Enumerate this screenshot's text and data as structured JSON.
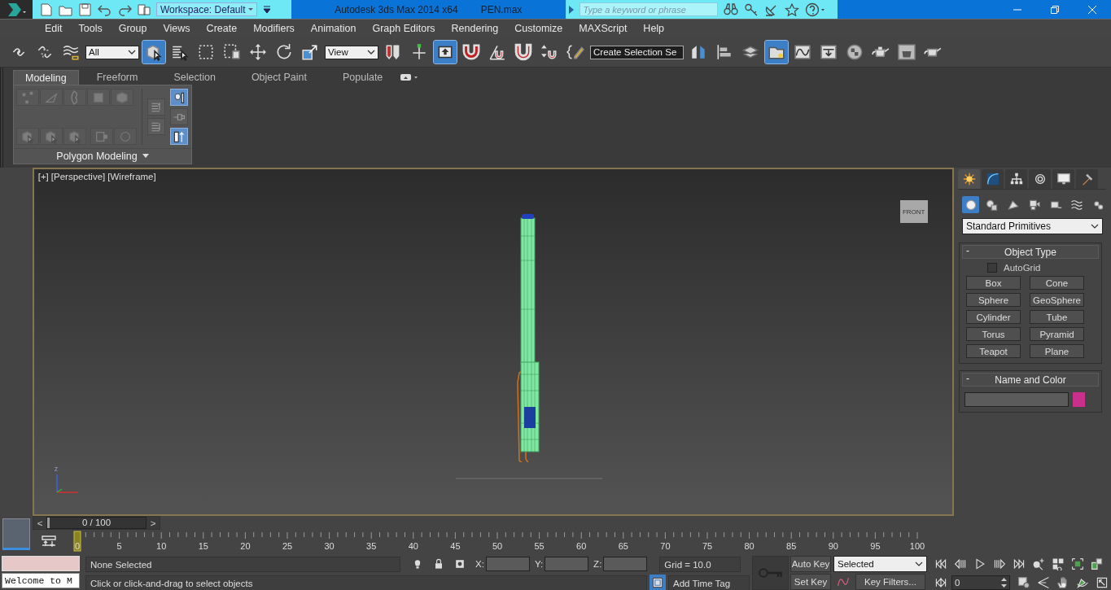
{
  "title_bar": {
    "workspace": "Workspace: Default",
    "app_title": "Autodesk 3ds Max  2014 x64",
    "file_name": "PEN.max",
    "search_placeholder": "Type a keyword or phrase"
  },
  "menu": [
    "Edit",
    "Tools",
    "Group",
    "Views",
    "Create",
    "Modifiers",
    "Animation",
    "Graph Editors",
    "Rendering",
    "Customize",
    "MAXScript",
    "Help"
  ],
  "main_toolbar": [
    {
      "kind": "button",
      "on": false
    },
    {
      "kind": "button",
      "on": false
    },
    {
      "kind": "button",
      "on": false
    },
    {
      "kind": "dropdown",
      "value": "All"
    },
    {
      "kind": "button",
      "on": true
    },
    {
      "kind": "button",
      "on": false
    },
    {
      "kind": "button",
      "on": false
    },
    {
      "kind": "button",
      "on": false
    },
    {
      "kind": "button",
      "on": false
    },
    {
      "kind": "button",
      "on": false
    },
    {
      "kind": "button",
      "on": false
    },
    {
      "kind": "dropdown",
      "value": "View"
    },
    {
      "kind": "button",
      "on": false
    },
    {
      "kind": "button",
      "on": false
    },
    {
      "kind": "button",
      "on": true
    },
    {
      "kind": "button",
      "on": false
    },
    {
      "kind": "button",
      "on": false
    },
    {
      "kind": "button",
      "on": false
    },
    {
      "kind": "button",
      "on": false
    },
    {
      "kind": "button",
      "on": false
    },
    {
      "kind": "dropdown",
      "value": "Create Selection Se"
    },
    {
      "kind": "button",
      "on": false
    },
    {
      "kind": "button",
      "on": false
    },
    {
      "kind": "button",
      "on": false
    },
    {
      "kind": "button",
      "on": true
    },
    {
      "kind": "button",
      "on": false
    },
    {
      "kind": "button",
      "on": false
    },
    {
      "kind": "button",
      "on": false
    },
    {
      "kind": "button",
      "on": false
    },
    {
      "kind": "button",
      "on": false
    },
    {
      "kind": "button",
      "on": false
    }
  ],
  "ribbon": {
    "tabs": [
      {
        "label": "Modeling",
        "selected": true
      },
      {
        "label": "Freeform",
        "selected": false
      },
      {
        "label": "Selection",
        "selected": false
      },
      {
        "label": "Object Paint",
        "selected": false
      },
      {
        "label": "Populate",
        "selected": false
      }
    ],
    "panel": {
      "title": "Polygon Modeling",
      "top_tools": [
        {
          "disabled": true
        },
        {
          "disabled": true
        },
        {
          "disabled": true
        },
        {
          "disabled": true
        },
        {
          "disabled": true
        }
      ],
      "bottom_tools": [
        {
          "disabled": true
        },
        {
          "disabled": true
        },
        {
          "disabled": true
        },
        {
          "disabled": true
        },
        {
          "disabled": true
        }
      ],
      "stack_tools": [
        {
          "on": false
        },
        {
          "on": false
        }
      ],
      "pin_tools": [
        {
          "on": true
        },
        {
          "on": false
        },
        {
          "on": true
        }
      ]
    }
  },
  "viewport": {
    "labels": [
      "[+]",
      "[Perspective]",
      "[Wireframe]"
    ],
    "viewcube": "FRONT",
    "axis_label": "z"
  },
  "command_panel": {
    "tabs": [
      {
        "selected": true
      },
      {
        "selected": false
      },
      {
        "selected": false
      },
      {
        "selected": false
      },
      {
        "selected": false
      },
      {
        "selected": false
      }
    ],
    "categories": [
      {
        "selected": true
      },
      {
        "selected": false
      },
      {
        "selected": false
      },
      {
        "selected": false
      },
      {
        "selected": false
      },
      {
        "selected": false
      },
      {
        "selected": false
      }
    ],
    "dropdown": "Standard Primitives",
    "object_type": {
      "collapse": "-",
      "title": "Object Type",
      "autogrid": {
        "label": "AutoGrid",
        "checked": false
      },
      "buttons": [
        "Box",
        "Cone",
        "Sphere",
        "GeoSphere",
        "Cylinder",
        "Tube",
        "Torus",
        "Pyramid",
        "Teapot",
        "Plane"
      ]
    },
    "name_and_color": {
      "collapse": "-",
      "title": "Name and Color",
      "color": "#c8308c"
    }
  },
  "time_slider": {
    "prev": "<",
    "value": "0 / 100",
    "next": ">",
    "level": 0
  },
  "track_bar": {
    "current": "0",
    "labels": [
      "5",
      "10",
      "15",
      "20",
      "25",
      "30",
      "35",
      "40",
      "45",
      "50",
      "55",
      "60",
      "65",
      "70",
      "75",
      "80",
      "85",
      "90",
      "95",
      "100"
    ]
  },
  "listener": {
    "output": "Welcome to M"
  },
  "status": {
    "selection": "None Selected",
    "x_label": "X:",
    "y_label": "Y:",
    "z_label": "Z:",
    "grid": "Grid = 10.0",
    "prompt": "Click or click-and-drag to select objects",
    "time_tag": "Add Time Tag",
    "auto_key": "Auto Key",
    "key_mode": "Selected",
    "set_key": "Set Key",
    "key_filters": "Key Filters...",
    "frame": "0"
  }
}
